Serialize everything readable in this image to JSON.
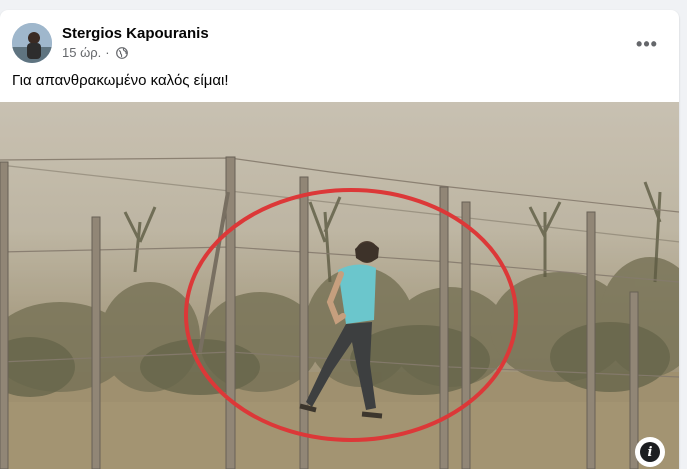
{
  "post": {
    "author_name": "Stergios Kapouranis",
    "timestamp": "15 ώρ.",
    "separator": "·",
    "audience_icon": "globe-icon",
    "more_icon": "more-options-icon",
    "more_label": "•••",
    "text": "Για απανθρακωμένο καλός είμαι!",
    "info_icon": "info-icon",
    "info_label": "i",
    "highlight_color": "#e0262a"
  }
}
